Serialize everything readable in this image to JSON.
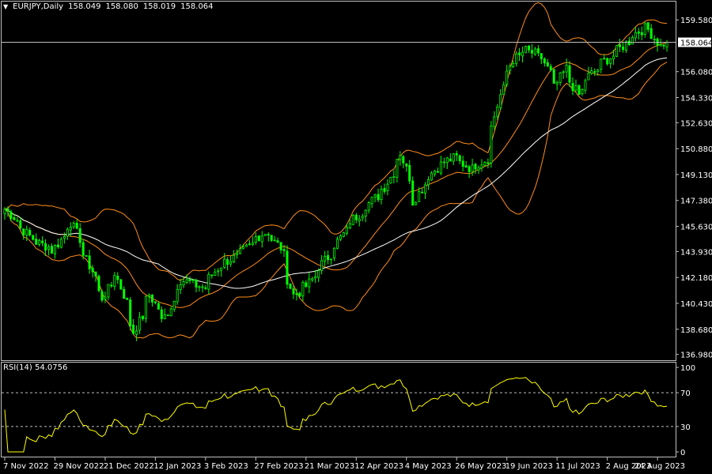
{
  "header": {
    "dropdown_icon": "triangle-down-icon",
    "symbol": "EURJPY,Daily",
    "ohlc": [
      "158.049",
      "158.080",
      "158.019",
      "158.064"
    ]
  },
  "rsi": {
    "label": "RSI(14)",
    "value": "54.0756"
  },
  "colors": {
    "background": "#000000",
    "candle": "#00ff00",
    "band": "#ff8c1a",
    "ma": "#ffffff",
    "rsi": "#ffff00",
    "grid": "#808080"
  },
  "chart_data": [
    {
      "type": "candlestick",
      "title": "EURJPY,Daily",
      "price_ticks": [
        "159.580",
        "157.830",
        "156.080",
        "154.330",
        "152.630",
        "150.880",
        "149.130",
        "147.380",
        "145.630",
        "143.930",
        "142.180",
        "140.430",
        "138.680",
        "136.980"
      ],
      "current_price": "158.064",
      "ylim": [
        136.8,
        160.6
      ],
      "x_ticks": [
        "7 Nov 2022",
        "29 Nov 2022",
        "21 Dec 2022",
        "12 Jan 2023",
        "3 Feb 2023",
        "27 Feb 2023",
        "21 Mar 2023",
        "12 Apr 2023",
        "4 May 2023",
        "26 May 2023",
        "19 Jun 2023",
        "11 Jul 2023",
        "2 Aug 2023",
        "24 Aug 2023"
      ],
      "close_keypoints": [
        [
          "7 Nov 2022",
          146.8
        ],
        [
          "18 Nov 2022",
          144.8
        ],
        [
          "28 Nov 2022",
          144.0
        ],
        [
          "6 Dec 2022",
          145.9
        ],
        [
          "12 Dec 2022",
          143.7
        ],
        [
          "20 Dec 2022",
          140.8
        ],
        [
          "26 Dec 2022",
          142.5
        ],
        [
          "3 Jan 2023",
          138.5
        ],
        [
          "10 Jan 2023",
          141.0
        ],
        [
          "16 Jan 2023",
          139.2
        ],
        [
          "24 Jan 2023",
          142.0
        ],
        [
          "3 Feb 2023",
          141.5
        ],
        [
          "10 Feb 2023",
          143.0
        ],
        [
          "20 Feb 2023",
          143.8
        ],
        [
          "27 Feb 2023",
          144.9
        ],
        [
          "3 Mar 2023",
          145.3
        ],
        [
          "9 Mar 2023",
          144.2
        ],
        [
          "15 Mar 2023",
          141.0
        ],
        [
          "21 Mar 2023",
          141.6
        ],
        [
          "27 Mar 2023",
          142.9
        ],
        [
          "3 Apr 2023",
          144.4
        ],
        [
          "10 Apr 2023",
          146.0
        ],
        [
          "18 Apr 2023",
          147.2
        ],
        [
          "25 Apr 2023",
          148.3
        ],
        [
          "2 May 2023",
          150.6
        ],
        [
          "8 May 2023",
          147.3
        ],
        [
          "12 May 2023",
          148.5
        ],
        [
          "19 May 2023",
          149.8
        ],
        [
          "26 May 2023",
          150.3
        ],
        [
          "2 Jun 2023",
          149.5
        ],
        [
          "9 Jun 2023",
          150.2
        ],
        [
          "15 Jun 2023",
          154.5
        ],
        [
          "21 Jun 2023",
          156.9
        ],
        [
          "27 Jun 2023",
          157.5
        ],
        [
          "4 Jul 2023",
          157.0
        ],
        [
          "10 Jul 2023",
          155.0
        ],
        [
          "14 Jul 2023",
          156.3
        ],
        [
          "20 Jul 2023",
          154.5
        ],
        [
          "25 Jul 2023",
          155.8
        ],
        [
          "1 Aug 2023",
          156.8
        ],
        [
          "7 Aug 2023",
          157.5
        ],
        [
          "14 Aug 2023",
          158.6
        ],
        [
          "20 Aug 2023",
          159.2
        ],
        [
          "25 Aug 2023",
          157.8
        ],
        [
          "29 Aug 2023",
          158.064
        ]
      ],
      "series": [
        {
          "name": "",
          "kind": "bollinger-upper"
        },
        {
          "name": "",
          "kind": "bollinger-middle"
        },
        {
          "name": "",
          "kind": "bollinger-lower"
        },
        {
          "name": "",
          "kind": "moving-average"
        }
      ]
    },
    {
      "type": "line",
      "title": "RSI(14) 54.0756",
      "y_ticks": [
        "100",
        "70",
        "30",
        "0"
      ],
      "levels": [
        70,
        30
      ],
      "ylim": [
        0,
        100
      ],
      "last_value": 54.0756
    }
  ]
}
